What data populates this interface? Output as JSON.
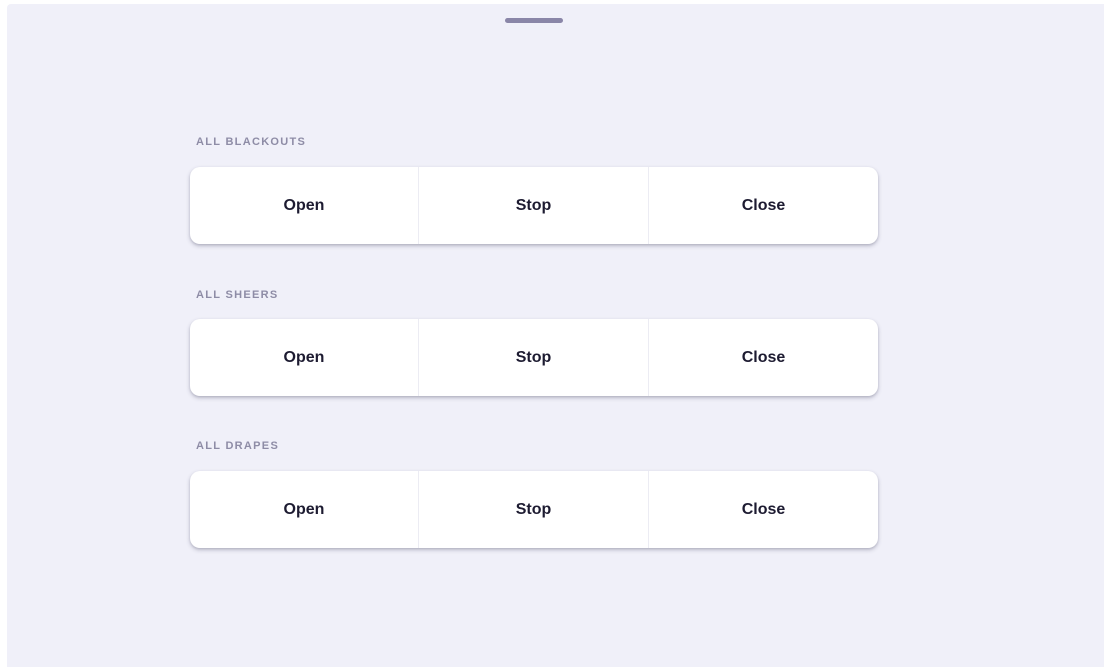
{
  "colors": {
    "background": "#f0f0f9",
    "handle": "#8a86a8",
    "label": "#8e8ca6",
    "button_bg": "#ffffff",
    "button_text": "#1d1b31"
  },
  "groups": [
    {
      "label": "ALL BLACKOUTS",
      "buttons": {
        "open": "Open",
        "stop": "Stop",
        "close": "Close"
      }
    },
    {
      "label": "ALL SHEERS",
      "buttons": {
        "open": "Open",
        "stop": "Stop",
        "close": "Close"
      }
    },
    {
      "label": "ALL DRAPES",
      "buttons": {
        "open": "Open",
        "stop": "Stop",
        "close": "Close"
      }
    }
  ]
}
